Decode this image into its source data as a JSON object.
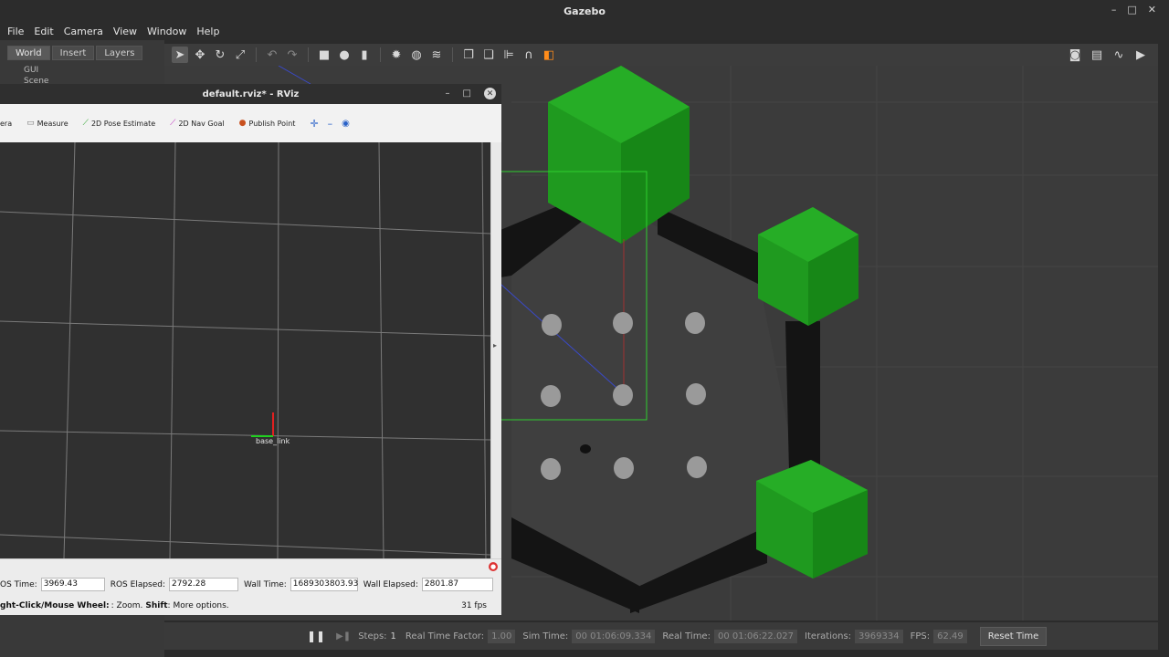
{
  "gazebo": {
    "title": "Gazebo",
    "menu": [
      "File",
      "Edit",
      "Camera",
      "View",
      "Window",
      "Help"
    ],
    "left_tabs": [
      "World",
      "Insert",
      "Layers"
    ],
    "tree": [
      "GUI",
      "Scene"
    ],
    "bottom": {
      "steps_label": "Steps:",
      "steps_value": "1",
      "rtf_label": "Real Time Factor:",
      "rtf_value": "1.00",
      "sim_time_label": "Sim Time:",
      "sim_time_value": "00 01:06:09.334",
      "real_time_label": "Real Time:",
      "real_time_value": "00 01:06:22.027",
      "iterations_label": "Iterations:",
      "iterations_value": "3969334",
      "fps_label": "FPS:",
      "fps_value": "62.49",
      "reset_label": "Reset Time"
    }
  },
  "rviz": {
    "title": "default.rviz* - RViz",
    "tools": [
      "era",
      "Measure",
      "2D Pose Estimate",
      "2D Nav Goal",
      "Publish Point"
    ],
    "frame_label": "base_link",
    "time": {
      "ros_time_label": "OS Time:",
      "ros_time_value": "3969.43",
      "ros_elapsed_label": "ROS Elapsed:",
      "ros_elapsed_value": "2792.28",
      "wall_time_label": "Wall Time:",
      "wall_time_value": "1689303803.93",
      "wall_elapsed_label": "Wall Elapsed:",
      "wall_elapsed_value": "2801.87"
    },
    "status_prefix": "ght-Click/Mouse Wheel:",
    "status_zoom": ": Zoom.",
    "status_shift": "Shift",
    "status_more": ": More options.",
    "fps": "31 fps"
  },
  "colors": {
    "obstacle_green": "#1f9a1f",
    "wall_black": "#141414",
    "floor": "#3b3b3b"
  }
}
